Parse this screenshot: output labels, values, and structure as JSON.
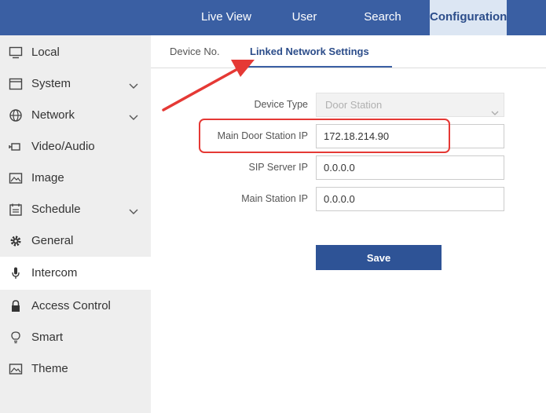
{
  "topnav": {
    "live_view": "Live View",
    "user": "User",
    "search": "Search",
    "configuration": "Configuration"
  },
  "sidebar": {
    "items": [
      {
        "label": "Local",
        "icon": "monitor-icon"
      },
      {
        "label": "System",
        "icon": "system-icon",
        "expandable": true
      },
      {
        "label": "Network",
        "icon": "globe-icon",
        "expandable": true
      },
      {
        "label": "Video/Audio",
        "icon": "camera-icon"
      },
      {
        "label": "Image",
        "icon": "image-icon"
      },
      {
        "label": "Schedule",
        "icon": "calendar-icon",
        "expandable": true
      },
      {
        "label": "General",
        "icon": "gear-icon"
      },
      {
        "label": "Intercom",
        "icon": "microphone-icon",
        "active": true
      },
      {
        "label": "Access Control",
        "icon": "lock-icon"
      },
      {
        "label": "Smart",
        "icon": "lightbulb-icon"
      },
      {
        "label": "Theme",
        "icon": "theme-image-icon"
      }
    ]
  },
  "tabs": {
    "device_no": "Device No.",
    "linked_network_settings": "Linked Network Settings"
  },
  "form": {
    "device_type_label": "Device Type",
    "device_type_value": "Door Station",
    "main_door_station_ip_label": "Main Door Station IP",
    "main_door_station_ip_value": "172.18.214.90",
    "sip_server_ip_label": "SIP Server IP",
    "sip_server_ip_value": "0.0.0.0",
    "main_station_ip_label": "Main Station IP",
    "main_station_ip_value": "0.0.0.0",
    "save_label": "Save"
  },
  "colors": {
    "topbar": "#3a5fa3",
    "active_tab_bg": "#dce6f3",
    "save_button": "#2e5396",
    "annotation_red": "#e53935"
  }
}
